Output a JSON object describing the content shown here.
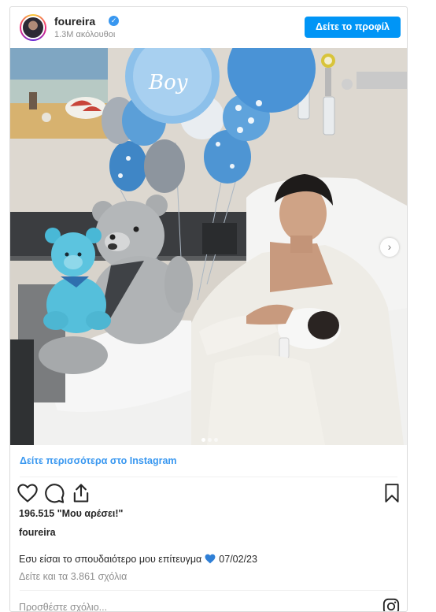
{
  "header": {
    "username": "foureira",
    "followers": "1.3M ακόλουθοι",
    "profile_button": "Δείτε το προφίλ"
  },
  "post": {
    "more_link": "Δείτε περισσότερα στο Instagram",
    "likes": "196.515 \"Μου αρέσει!\"",
    "caption_user": "foureira",
    "caption_text": "Εσυ είσαι το σπουδαιότερο μου επίτευγμα",
    "caption_date": "07/02/23",
    "view_comments": "Δείτε και τα 3.861 σχόλια",
    "add_comment_placeholder": "Προσθέστε σχόλιο..."
  },
  "photo": {
    "balloon_text": "Boy",
    "carousel_dots": 3,
    "active_dot": 1
  },
  "icons": {
    "verified": "verified-badge-icon",
    "like": "heart-outline-icon",
    "comment": "comment-bubble-icon",
    "share": "share-upload-icon",
    "save": "bookmark-icon",
    "next": "chevron-right-icon",
    "instagram": "instagram-logo-icon",
    "emoji": "blue-heart-emoji"
  },
  "colors": {
    "accent": "#0095f6",
    "link": "#3897f0",
    "muted": "#8e8e8e",
    "emoji_heart": "#2f7fd6"
  }
}
